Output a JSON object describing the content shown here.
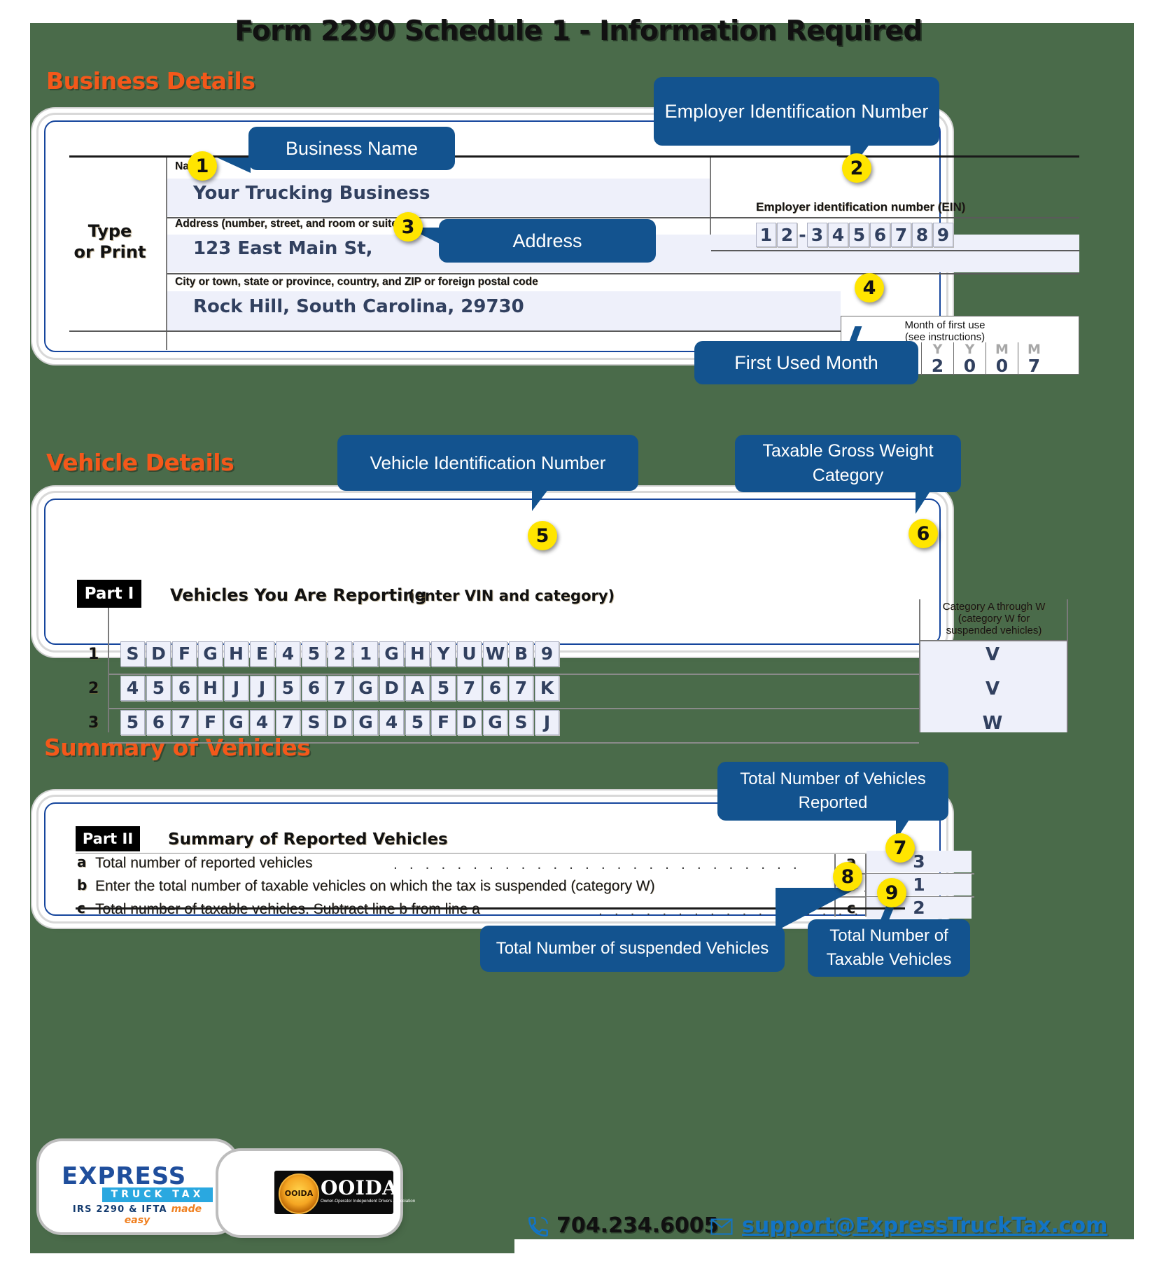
{
  "page": {
    "title": "Form 2290 Schedule 1 - Information Required",
    "bg_color": "#4a6b4a",
    "accent_orange": "#f4581a",
    "callout_blue": "#13538f",
    "marker_yellow": "#ffe500",
    "form_border_blue": "#16469d",
    "value_navy": "#31405f"
  },
  "sections": {
    "business": "Business Details",
    "vehicle": "Vehicle Details",
    "summary": "Summary of Vehicles"
  },
  "business_form": {
    "type_or_print": "Type\nor Print",
    "type_line1": "Type",
    "type_line2": "or Print",
    "name_label": "Name",
    "name_value": "Your Trucking Business",
    "address_label": "Address (number, street, and room or suite no.)",
    "address_value": "123 East Main St,",
    "city_label": "City or town, state or province, country, and ZIP or foreign postal code",
    "city_value": "Rock Hill, South Carolina, 29730",
    "ein_label": "Employer identification number (EIN)",
    "ein_digits": [
      "1",
      "2",
      "-",
      "3",
      "4",
      "5",
      "6",
      "7",
      "8",
      "9"
    ],
    "mfu_label_line1": "Month of first use",
    "mfu_label_line2": "(see instructions)",
    "mfu_headers": [
      "Y",
      "Y",
      "Y",
      "Y",
      "M",
      "M"
    ],
    "mfu_digits": [
      "2",
      "0",
      "2",
      "0",
      "0",
      "7"
    ]
  },
  "vehicle_form": {
    "part_tag": "Part I",
    "part_title": "Vehicles You Are Reporting",
    "part_subtitle": "(enter VIN and category)",
    "category_header_line1": "Category A through W",
    "category_header_line2": "(category W for",
    "category_header_line3": "suspended vehicles)",
    "rows": [
      {
        "no": "1",
        "vin": "SDFGHE4521GHYUWB9",
        "category": "V"
      },
      {
        "no": "2",
        "vin": "456HJJ567GDA5767K",
        "category": "V"
      },
      {
        "no": "3",
        "vin": "567FG47SDG45FDGSJ",
        "category": "W"
      }
    ]
  },
  "summary_form": {
    "part_tag": "Part II",
    "part_title": "Summary of Reported Vehicles",
    "lines": [
      {
        "letter": "a",
        "text": "Total number of reported vehicles",
        "key": "a",
        "value": "3"
      },
      {
        "letter": "b",
        "text": "Enter the total number of taxable vehicles on which the tax is suspended (category W)",
        "key": "b",
        "value": "1"
      },
      {
        "letter": "c",
        "text": "Total number of taxable vehicles. Subtract line b from line a",
        "key": "c",
        "value": "2"
      }
    ]
  },
  "callouts": [
    {
      "n": "1",
      "label": "Business Name"
    },
    {
      "n": "2",
      "label": "Employer Identification Number"
    },
    {
      "n": "3",
      "label": "Address"
    },
    {
      "n": "4",
      "label": "First Used Month"
    },
    {
      "n": "5",
      "label": "Vehicle Identification Number"
    },
    {
      "n": "6",
      "label": "Taxable Gross Weight Category"
    },
    {
      "n": "7",
      "label": "Total Number of Vehicles Reported"
    },
    {
      "n": "8",
      "label": "Total Number of suspended Vehicles"
    },
    {
      "n": "9",
      "label": "Total Number of Taxable Vehicles"
    }
  ],
  "footer": {
    "brand_express": "E",
    "brand_xpress": "XPRESS",
    "brand_truck_tax": "TRUCK TAX",
    "brand_tagline_main": "IRS 2290 & IFTA",
    "brand_tagline_italic": "made easy",
    "ooida_word": "OOIDA",
    "ooida_seal": "OOIDA",
    "ooida_sub": "Owner-Operator Independent Drivers Association",
    "phone": "704.234.6005",
    "email": "support@ExpressTruckTax.com",
    "phone_icon": "phone-icon",
    "mail_icon": "mail-icon"
  }
}
